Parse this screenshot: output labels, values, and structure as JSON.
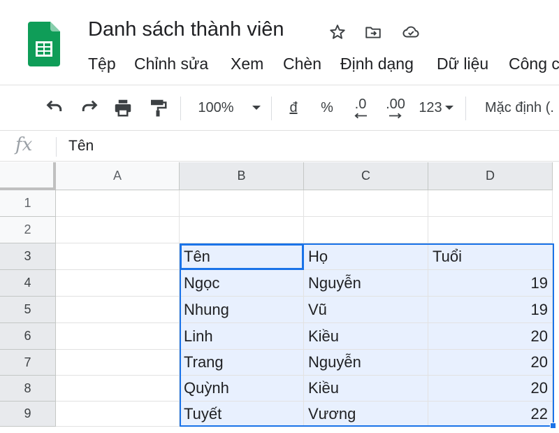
{
  "document": {
    "title": "Danh sách thành viên"
  },
  "header_icons": [
    "star-icon",
    "move-to-folder-icon",
    "cloud-status-icon"
  ],
  "menu": [
    "Tệp",
    "Chỉnh sửa",
    "Xem",
    "Chèn",
    "Định dạng",
    "Dữ liệu",
    "Công c"
  ],
  "toolbar": {
    "zoom": "100%",
    "currency": "đ",
    "percent": "%",
    "decrease_decimal": ".0",
    "increase_decimal": ".00",
    "more_formats": "123",
    "font": "Mặc định (."
  },
  "formula_bar": {
    "fx": "fx",
    "value": "Tên"
  },
  "grid": {
    "columns": [
      "A",
      "B",
      "C",
      "D"
    ],
    "rows": [
      "1",
      "2",
      "3",
      "4",
      "5",
      "6",
      "7",
      "8",
      "9"
    ],
    "cells": {
      "B3": "Tên",
      "C3": "Họ",
      "D3": "Tuổi",
      "B4": "Ngọc",
      "C4": "Nguyễn",
      "D4": "19",
      "B5": "Nhung",
      "C5": "Vũ",
      "D5": "19",
      "B6": "Linh",
      "C6": "Kiều",
      "D6": "20",
      "B7": "Trang",
      "C7": "Nguyễn",
      "D7": "20",
      "B8": "Quỳnh",
      "C8": "Kiều",
      "D8": "20",
      "B9": "Tuyết",
      "C9": "Vương",
      "D9": "22"
    },
    "selection": "B3:D9",
    "active_cell": "B3"
  },
  "colors": {
    "brand": "#0f9d58",
    "selection": "#1a73e8",
    "selection_fill": "#e8f0fe"
  }
}
